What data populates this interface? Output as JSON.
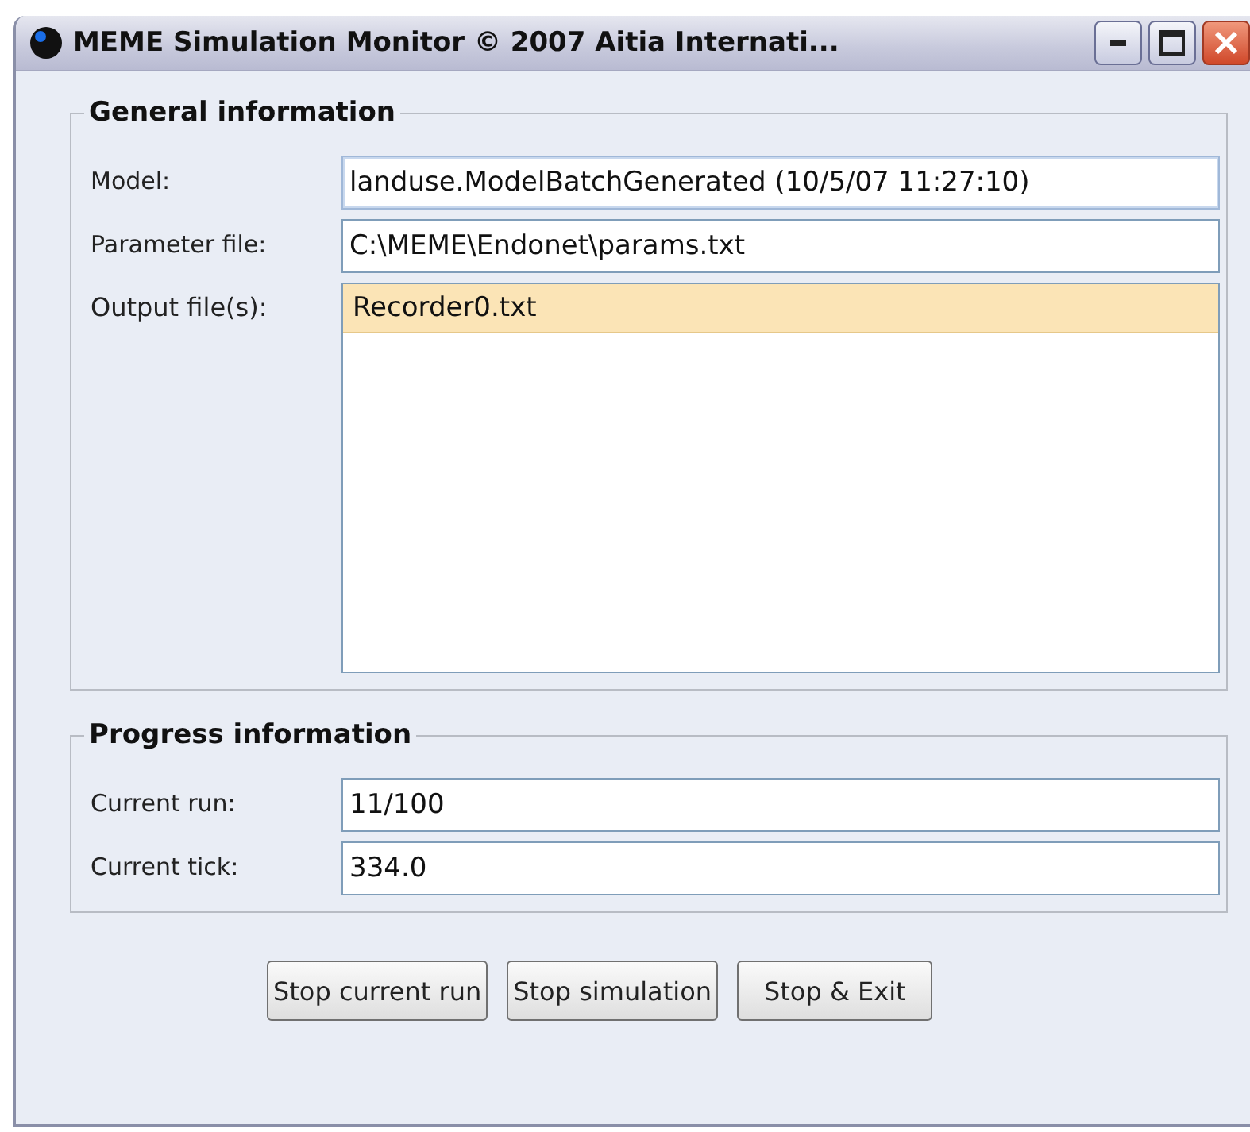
{
  "window": {
    "title": "MEME Simulation Monitor © 2007 Aitia Internati..."
  },
  "general": {
    "title": "General information",
    "model": {
      "label": "Model:",
      "value": "landuse.ModelBatchGenerated (10/5/07 11:27:10)"
    },
    "parameter_file": {
      "label": "Parameter file:",
      "value": "C:\\MEME\\Endonet\\params.txt"
    },
    "output_files": {
      "label": "Output file(s):",
      "items": [
        {
          "text": "Recorder0.txt",
          "selected": true
        }
      ]
    }
  },
  "progress": {
    "title": "Progress information",
    "fields": [
      {
        "label": "Current run:",
        "value": "11/100"
      },
      {
        "label": "Current tick:",
        "value": "334.0"
      }
    ]
  },
  "buttons": [
    "Stop current run",
    "Stop simulation",
    "Stop & Exit"
  ]
}
